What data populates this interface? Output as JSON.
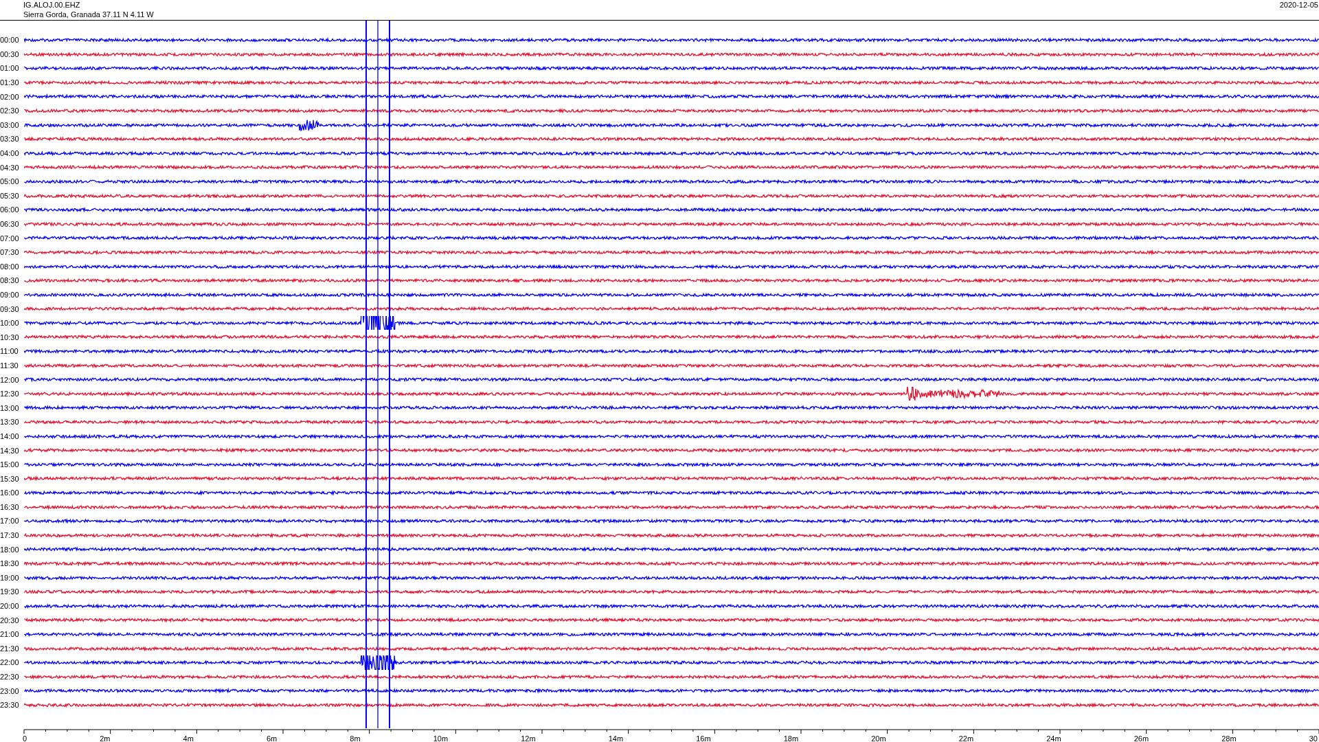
{
  "header": {
    "station": "IG.ALOJ.00.EHZ",
    "location": "Sierra Gorda, Granada  37.11 N 4.11 W",
    "date": "2020-12-05"
  },
  "rows": [
    {
      "time": "00:00",
      "color": "#0000ff"
    },
    {
      "time": "00:30",
      "color": "#e8112d"
    },
    {
      "time": "01:00",
      "color": "#0000ff"
    },
    {
      "time": "01:30",
      "color": "#e8112d"
    },
    {
      "time": "02:00",
      "color": "#0000ff"
    },
    {
      "time": "02:30",
      "color": "#e8112d"
    },
    {
      "time": "03:00",
      "color": "#0000ff"
    },
    {
      "time": "03:30",
      "color": "#e8112d"
    },
    {
      "time": "04:00",
      "color": "#0000ff"
    },
    {
      "time": "04:30",
      "color": "#e8112d"
    },
    {
      "time": "05:00",
      "color": "#0000ff"
    },
    {
      "time": "05:30",
      "color": "#e8112d"
    },
    {
      "time": "06:00",
      "color": "#0000ff"
    },
    {
      "time": "06:30",
      "color": "#e8112d"
    },
    {
      "time": "07:00",
      "color": "#0000ff"
    },
    {
      "time": "07:30",
      "color": "#e8112d"
    },
    {
      "time": "08:00",
      "color": "#0000ff"
    },
    {
      "time": "08:30",
      "color": "#e8112d"
    },
    {
      "time": "09:00",
      "color": "#0000ff"
    },
    {
      "time": "09:30",
      "color": "#e8112d"
    },
    {
      "time": "10:00",
      "color": "#0000ff"
    },
    {
      "time": "10:30",
      "color": "#e8112d"
    },
    {
      "time": "11:00",
      "color": "#0000ff"
    },
    {
      "time": "11:30",
      "color": "#e8112d"
    },
    {
      "time": "12:00",
      "color": "#0000ff"
    },
    {
      "time": "12:30",
      "color": "#e8112d"
    },
    {
      "time": "13:00",
      "color": "#0000ff"
    },
    {
      "time": "13:30",
      "color": "#e8112d"
    },
    {
      "time": "14:00",
      "color": "#0000ff"
    },
    {
      "time": "14:30",
      "color": "#e8112d"
    },
    {
      "time": "15:00",
      "color": "#0000ff"
    },
    {
      "time": "15:30",
      "color": "#e8112d"
    },
    {
      "time": "16:00",
      "color": "#0000ff"
    },
    {
      "time": "16:30",
      "color": "#e8112d"
    },
    {
      "time": "17:00",
      "color": "#0000ff"
    },
    {
      "time": "17:30",
      "color": "#e8112d"
    },
    {
      "time": "18:00",
      "color": "#0000ff"
    },
    {
      "time": "18:30",
      "color": "#e8112d"
    },
    {
      "time": "19:00",
      "color": "#0000ff"
    },
    {
      "time": "19:30",
      "color": "#e8112d"
    },
    {
      "time": "20:00",
      "color": "#0000ff"
    },
    {
      "time": "20:30",
      "color": "#e8112d"
    },
    {
      "time": "21:00",
      "color": "#0000ff"
    },
    {
      "time": "21:30",
      "color": "#e8112d"
    },
    {
      "time": "22:00",
      "color": "#0000ff"
    },
    {
      "time": "22:30",
      "color": "#e8112d"
    },
    {
      "time": "23:00",
      "color": "#0000ff"
    },
    {
      "time": "23:30",
      "color": "#e8112d"
    }
  ],
  "axis": {
    "ticks": [
      "0",
      "2m",
      "4m",
      "6m",
      "8m",
      "10m",
      "12m",
      "14m",
      "16m",
      "18m",
      "20m",
      "22m",
      "24m",
      "26m",
      "28m",
      "30"
    ]
  }
}
